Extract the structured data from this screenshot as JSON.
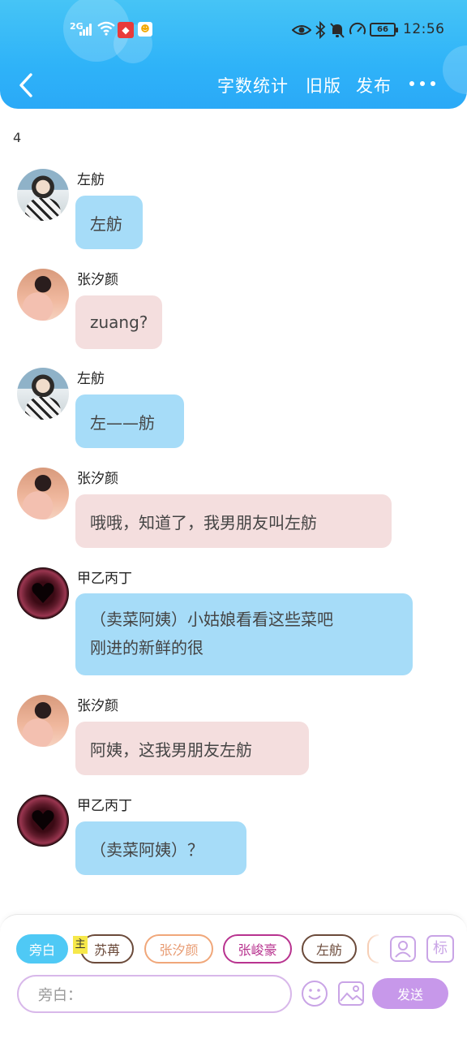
{
  "status_bar": {
    "network": "2G",
    "battery": "66",
    "time": "12:56"
  },
  "nav": {
    "back_icon": "chevron-left-icon",
    "word_count": "字数统计",
    "old_version": "旧版",
    "publish": "发布",
    "more_icon": "more-horizontal-icon"
  },
  "counter": "4",
  "messages": [
    {
      "name": "左舫",
      "text": "左舫",
      "color": "blue",
      "avatar": "avatar-photo-boy"
    },
    {
      "name": "张汐颜",
      "text": "zuang?",
      "color": "pink",
      "avatar": "avatar-photo-girl"
    },
    {
      "name": "左舫",
      "text": "左——舫",
      "color": "blue",
      "avatar": "avatar-photo-boy"
    },
    {
      "name": "张汐颜",
      "text": "哦哦，知道了，我男朋友叫左舫",
      "color": "pink",
      "avatar": "avatar-photo-girl"
    },
    {
      "name": "甲乙丙丁",
      "line1": "（卖菜阿姨）小姑娘看看这些菜吧",
      "line2": "刚进的新鲜的很",
      "color": "blue",
      "avatar": "heart-avatar"
    },
    {
      "name": "张汐颜",
      "text": "阿姨，这我男朋友左舫",
      "color": "pink",
      "avatar": "avatar-photo-girl"
    },
    {
      "name": "甲乙丙丁",
      "text": "（卖菜阿姨）？",
      "color": "blue",
      "avatar": "heart-avatar"
    }
  ],
  "roles": {
    "narrator": "旁白",
    "master_tag": "主",
    "r1": "苏苒",
    "r2": "张汐颜",
    "r3": "张峻豪",
    "r4": "左舫"
  },
  "input": {
    "placeholder": "旁白："
  },
  "send_label": "发送",
  "tools": {
    "character_icon": "character-card-icon",
    "tag_icon": "标",
    "emoji_icon": "smiley-icon",
    "image_icon": "image-icon"
  },
  "colors": {
    "header": "#2fb3f8",
    "bubble_blue": "#a6dcf8",
    "bubble_pink": "#f4dede",
    "send": "#c798ea",
    "narrator_chip": "#4fc9f5"
  }
}
